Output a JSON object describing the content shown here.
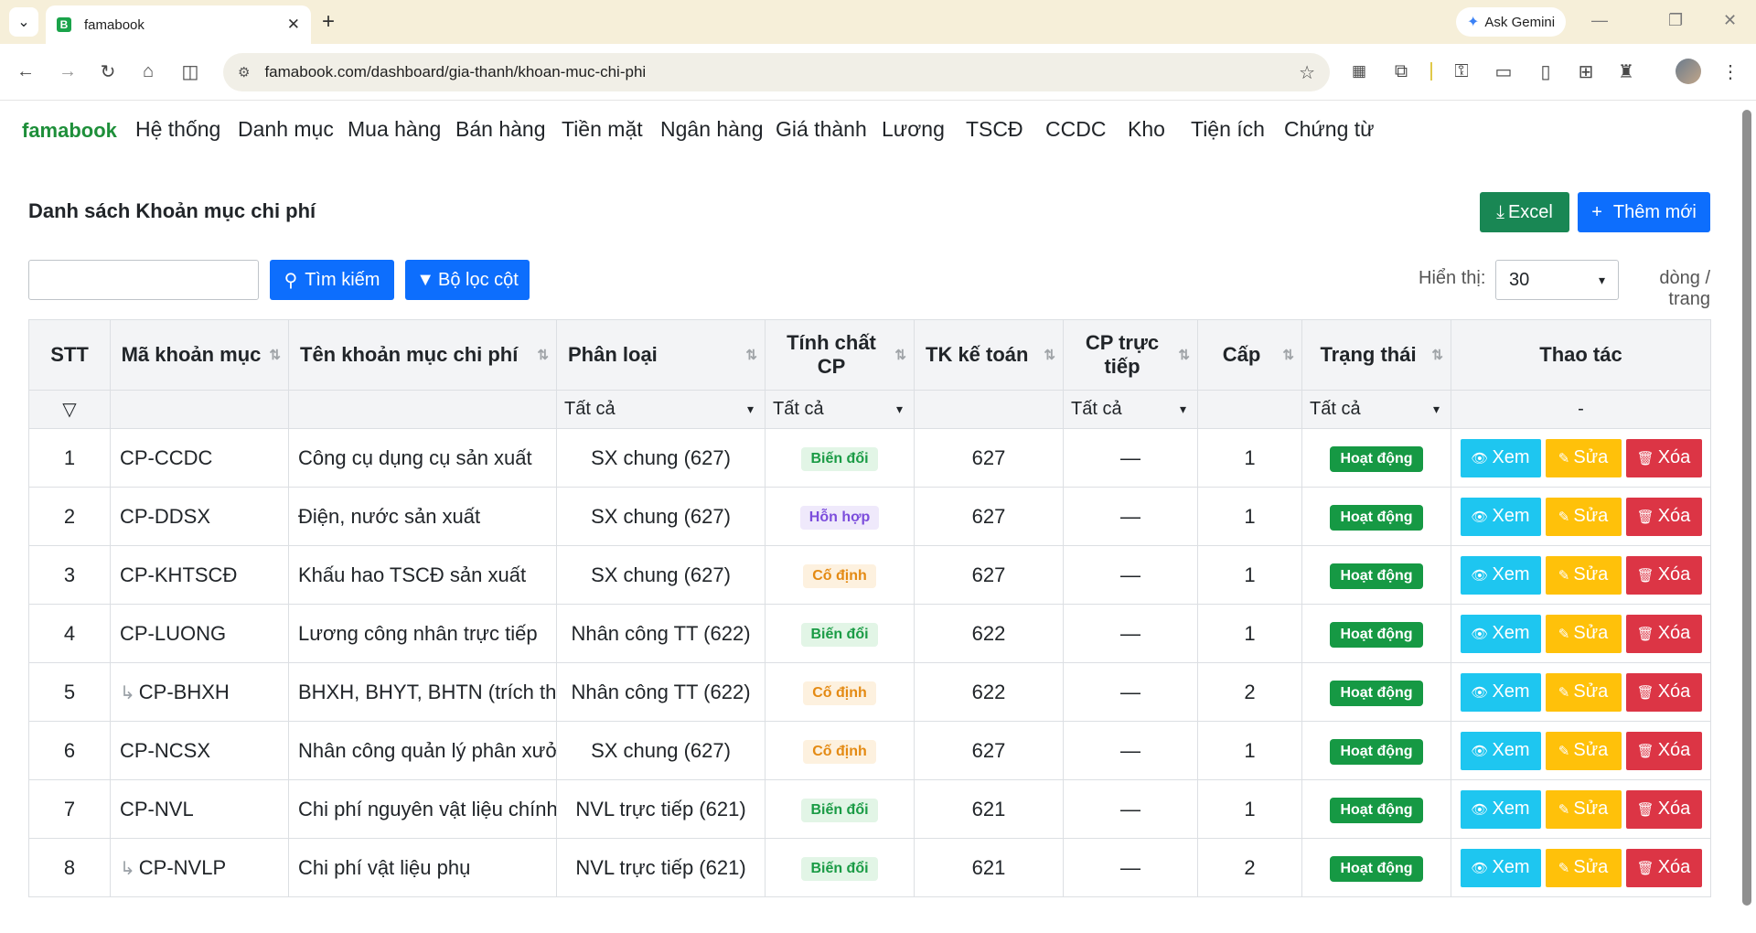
{
  "browser": {
    "tab_title": "famabook",
    "favicon_letter": "B",
    "url": "famabook.com/dashboard/gia-thanh/khoan-muc-chi-phi",
    "gemini_label": "Ask Gemini"
  },
  "nav": {
    "brand": "famabook",
    "items": [
      "Hệ thống",
      "Danh mục",
      "Mua hàng",
      "Bán hàng",
      "Tiền mặt",
      "Ngân hàng",
      "Giá thành",
      "Lương",
      "TSCĐ",
      "CCDC",
      "Kho",
      "Tiện ích",
      "Chứng từ"
    ]
  },
  "page": {
    "title": "Danh sách Khoản mục chi phí",
    "excel_label": "Excel",
    "add_label": "Thêm mới",
    "search_value": "",
    "search_label": "Tìm kiếm",
    "filter_label": "Bộ lọc cột",
    "show_label": "Hiển thị:",
    "page_size": "30",
    "per_page_label": "dòng / trang"
  },
  "table": {
    "headers": {
      "stt": "STT",
      "ma": "Mã khoản mục",
      "ten": "Tên khoản mục chi phí",
      "phan_loai": "Phân loại",
      "tinh_chat": "Tính chất CP",
      "tk": "TK kế toán",
      "cp_truc_tiep": "CP trực tiếp",
      "cap": "Cấp",
      "trang_thai": "Trạng thái",
      "thao_tac": "Thao tác"
    },
    "filters": {
      "phan_loai": "Tất cả",
      "tinh_chat": "Tất cả",
      "cp_truc_tiep": "Tất cả",
      "trang_thai": "Tất cả",
      "thao_tac": "-"
    },
    "action_labels": {
      "view": "Xem",
      "edit": "Sửa",
      "delete": "Xóa"
    },
    "rows": [
      {
        "stt": "1",
        "ma": "CP-CCDC",
        "child": false,
        "ten": "Công cụ dụng cụ sản xuất",
        "phan_loai": "SX chung (627)",
        "tinh_chat": "Biến đổi",
        "tinh_chat_type": "bd",
        "tk": "627",
        "cp_truc_tiep": "—",
        "cap": "1",
        "trang_thai": "Hoạt động"
      },
      {
        "stt": "2",
        "ma": "CP-DDSX",
        "child": false,
        "ten": "Điện, nước sản xuất",
        "phan_loai": "SX chung (627)",
        "tinh_chat": "Hỗn hợp",
        "tinh_chat_type": "hh",
        "tk": "627",
        "cp_truc_tiep": "—",
        "cap": "1",
        "trang_thai": "Hoạt động"
      },
      {
        "stt": "3",
        "ma": "CP-KHTSCĐ",
        "child": false,
        "ten": "Khấu hao TSCĐ sản xuất",
        "phan_loai": "SX chung (627)",
        "tinh_chat": "Cố định",
        "tinh_chat_type": "cd",
        "tk": "627",
        "cp_truc_tiep": "—",
        "cap": "1",
        "trang_thai": "Hoạt động"
      },
      {
        "stt": "4",
        "ma": "CP-LUONG",
        "child": false,
        "ten": "Lương công nhân trực tiếp",
        "phan_loai": "Nhân công TT (622)",
        "tinh_chat": "Biến đổi",
        "tinh_chat_type": "bd",
        "tk": "622",
        "cp_truc_tiep": "—",
        "cap": "1",
        "trang_thai": "Hoạt động"
      },
      {
        "stt": "5",
        "ma": "CP-BHXH",
        "child": true,
        "ten": "BHXH, BHYT, BHTN (trích th",
        "phan_loai": "Nhân công TT (622)",
        "tinh_chat": "Cố định",
        "tinh_chat_type": "cd",
        "tk": "622",
        "cp_truc_tiep": "—",
        "cap": "2",
        "trang_thai": "Hoạt động"
      },
      {
        "stt": "6",
        "ma": "CP-NCSX",
        "child": false,
        "ten": "Nhân công quản lý phân xưở",
        "phan_loai": "SX chung (627)",
        "tinh_chat": "Cố định",
        "tinh_chat_type": "cd",
        "tk": "627",
        "cp_truc_tiep": "—",
        "cap": "1",
        "trang_thai": "Hoạt động"
      },
      {
        "stt": "7",
        "ma": "CP-NVL",
        "child": false,
        "ten": "Chi phí nguyên vật liệu chính",
        "phan_loai": "NVL trực tiếp (621)",
        "tinh_chat": "Biến đổi",
        "tinh_chat_type": "bd",
        "tk": "621",
        "cp_truc_tiep": "—",
        "cap": "1",
        "trang_thai": "Hoạt động"
      },
      {
        "stt": "8",
        "ma": "CP-NVLP",
        "child": true,
        "ten": "Chi phí vật liệu phụ",
        "phan_loai": "NVL trực tiếp (621)",
        "tinh_chat": "Biến đổi",
        "tinh_chat_type": "bd",
        "tk": "621",
        "cp_truc_tiep": "—",
        "cap": "2",
        "trang_thai": "Hoạt động"
      }
    ]
  }
}
